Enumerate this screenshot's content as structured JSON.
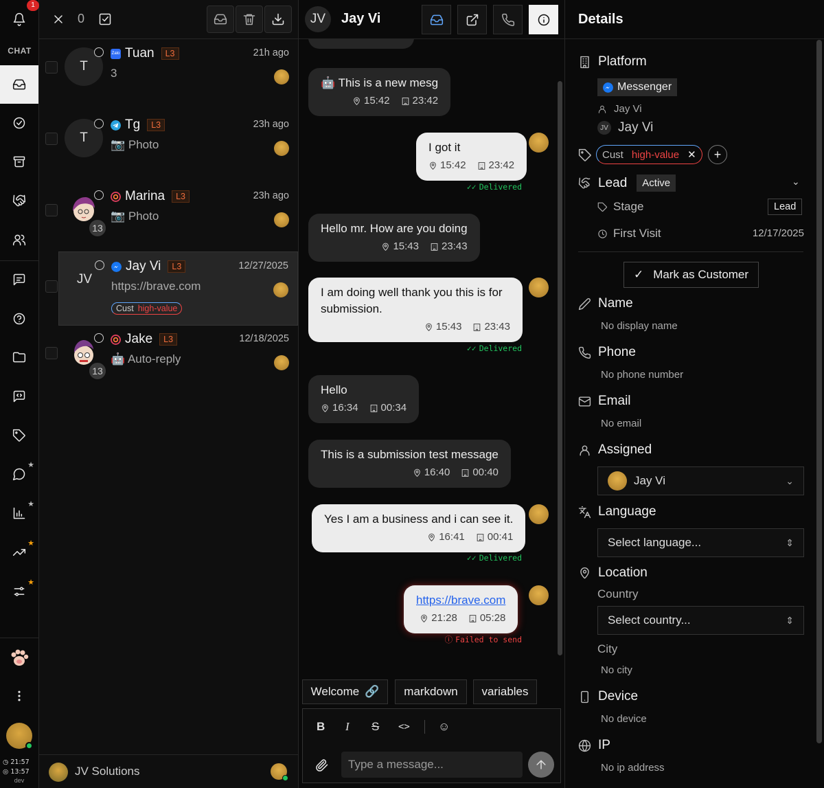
{
  "rail": {
    "notifications": "1",
    "section_label": "CHAT",
    "clock_1": "21:57",
    "clock_2": "13:57",
    "env": "dev"
  },
  "list": {
    "selected_count": "0",
    "conversations": [
      {
        "name": "Tuan",
        "level": "L3",
        "time": "21h ago",
        "preview": "3",
        "avatar": "T",
        "platform": "zalo"
      },
      {
        "name": "Tg",
        "level": "L3",
        "time": "23h ago",
        "preview": "📷 Photo",
        "avatar": "T",
        "platform": "telegram"
      },
      {
        "name": "Marina",
        "level": "L3",
        "time": "23h ago",
        "preview": "📷 Photo",
        "avatar": "",
        "platform": "instagram",
        "count": "13"
      },
      {
        "name": "Jay Vi",
        "level": "L3",
        "time": "12/27/2025",
        "preview": "https://brave.com",
        "avatar": "JV",
        "platform": "messenger",
        "tag_key": "Cust",
        "tag_value": "high-value"
      },
      {
        "name": "Jake",
        "level": "L3",
        "time": "12/18/2025",
        "preview": "🤖 Auto-reply",
        "avatar": "",
        "platform": "instagram",
        "count": "13"
      }
    ],
    "footer_org": "JV Solutions"
  },
  "chat": {
    "avatar": "JV",
    "name": "Jay Vi",
    "messages": [
      {
        "dir": "in",
        "text": "🤖 This is a new mesg",
        "t1": "15:42",
        "t2": "23:42"
      },
      {
        "dir": "out",
        "text": "I got it",
        "t1": "15:42",
        "t2": "23:42",
        "status": "Delivered"
      },
      {
        "dir": "in",
        "text": "Hello mr. How are you doing",
        "t1": "15:43",
        "t2": "23:43"
      },
      {
        "dir": "out",
        "text": "I am doing well thank you this is for submission.",
        "t1": "15:43",
        "t2": "23:43",
        "status": "Delivered"
      },
      {
        "dir": "in",
        "text": "Hello",
        "t1": "16:34",
        "t2": "00:34"
      },
      {
        "dir": "in",
        "text": "This is a submission test message",
        "t1": "16:40",
        "t2": "00:40"
      },
      {
        "dir": "out",
        "text": "Yes I am a business and i can see it.",
        "t1": "16:41",
        "t2": "00:41",
        "status": "Delivered"
      },
      {
        "dir": "out",
        "text": "https://brave.com",
        "t1": "21:28",
        "t2": "05:28",
        "status": "Failed to send"
      }
    ],
    "quick_replies": [
      "Welcome",
      "markdown",
      "variables"
    ],
    "input_placeholder": "Type a message..."
  },
  "details": {
    "title": "Details",
    "platform_label": "Platform",
    "platform": "Messenger",
    "account_name": "Jay Vi",
    "contact_avatar": "JV",
    "contact_name": "Jay Vi",
    "tag_key": "Cust",
    "tag_value": "high-value",
    "lead_label": "Lead",
    "lead_status": "Active",
    "stage_label": "Stage",
    "stage_value": "Lead",
    "first_visit_label": "First Visit",
    "first_visit_value": "12/17/2025",
    "mark_customer": "Mark as Customer",
    "name_label": "Name",
    "name_value": "No display name",
    "phone_label": "Phone",
    "phone_value": "No phone number",
    "email_label": "Email",
    "email_value": "No email",
    "assigned_label": "Assigned",
    "assigned_value": "Jay Vi",
    "language_label": "Language",
    "language_placeholder": "Select language...",
    "location_label": "Location",
    "country_label": "Country",
    "country_placeholder": "Select country...",
    "city_label": "City",
    "city_value": "No city",
    "device_label": "Device",
    "device_value": "No device",
    "ip_label": "IP",
    "ip_value": "No ip address"
  },
  "colors": {
    "accent": "#ef4444",
    "delivered": "#22c55e",
    "link": "#2563eb",
    "level": "#ef6c3c"
  }
}
